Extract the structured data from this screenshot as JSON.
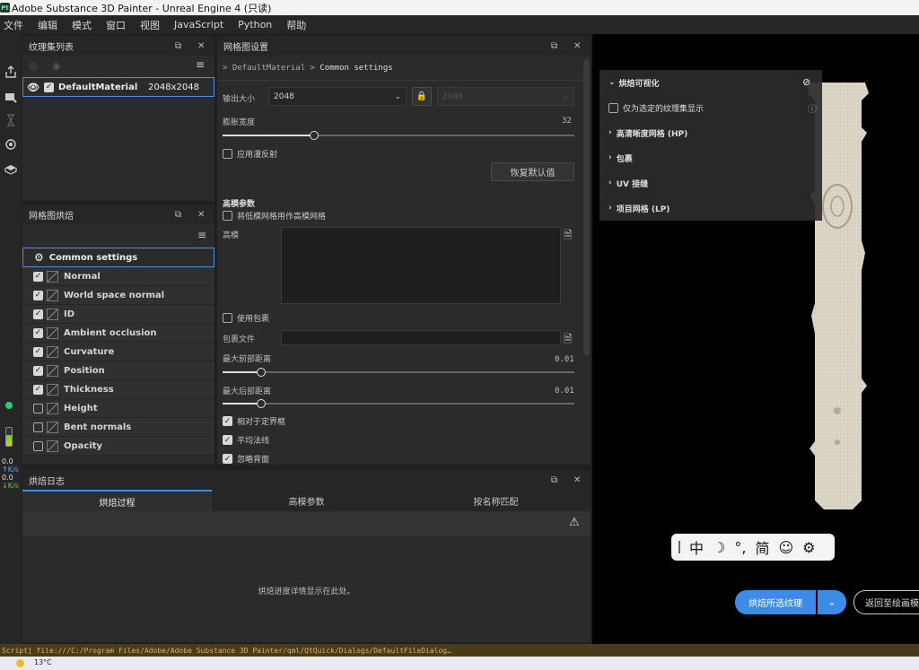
{
  "window": {
    "app_icon": "Pt",
    "title": "Adobe Substance 3D Painter - Unreal Engine 4 (只读)"
  },
  "menu": [
    "文件",
    "编辑",
    "模式",
    "窗口",
    "视图",
    "JavaScript",
    "Python",
    "帮助"
  ],
  "leftbar": {
    "rate1_value": "0.0",
    "rate1_unit": "K/s",
    "rate2_value": "0.0",
    "rate2_unit": "K/s"
  },
  "texture_sets": {
    "title": "纹理集列表",
    "material": {
      "name": "DefaultMaterial",
      "size": "2048x2048"
    }
  },
  "mesh_bake": {
    "title": "网格图烘焙",
    "common_settings": "Common settings",
    "maps": [
      {
        "name": "Normal",
        "checked": true
      },
      {
        "name": "World space normal",
        "checked": true
      },
      {
        "name": "ID",
        "checked": true
      },
      {
        "name": "Ambient occlusion",
        "checked": true
      },
      {
        "name": "Curvature",
        "checked": true
      },
      {
        "name": "Position",
        "checked": true
      },
      {
        "name": "Thickness",
        "checked": true
      },
      {
        "name": "Height",
        "checked": false
      },
      {
        "name": "Bent normals",
        "checked": false
      },
      {
        "name": "Opacity",
        "checked": false
      }
    ]
  },
  "settings": {
    "title": "网格图设置",
    "breadcrumb_root": "DefaultMaterial",
    "breadcrumb_leaf": "Common settings",
    "output_size_label": "输出大小",
    "output_size_value": "2048",
    "output_size_locked_value": "2048",
    "dilation_label": "膨胀宽度",
    "dilation_value": "32",
    "dilation_fraction": 0.26,
    "apply_diffusion_label": "应用漫反射",
    "reset_button": "恢复默认值",
    "highpoly_section": "高模参数",
    "use_lowpoly_label": "将低模网格用作高模网格",
    "highpoly_label": "高模",
    "use_cage_label": "使用包裹",
    "cage_file_label": "包裹文件",
    "max_front_label": "最大前部距离",
    "max_front_value": "0.01",
    "max_front_fraction": 0.11,
    "max_rear_label": "最大后部距离",
    "max_rear_value": "0.01",
    "max_rear_fraction": 0.11,
    "relative_bbox_label": "相对于定界框",
    "average_normals_label": "平均法线",
    "ignore_backface_label": "忽略背面"
  },
  "bake_log": {
    "title": "烘焙日志",
    "tabs": [
      "烘焙过程",
      "高模参数",
      "按名称匹配"
    ],
    "empty_message": "烘焙进度详情显示在此处。"
  },
  "viewport": {
    "bake_visibility_title": "烘焙可视化",
    "only_selected_label": "仅为选定的纹理集显示",
    "items": [
      "高清晰度网格 (HP)",
      "包裹",
      "UV 接缝",
      "项目网格 (LP)"
    ],
    "ime_items": [
      "中",
      "☽",
      "°,",
      "简",
      "☺",
      "⚙"
    ],
    "bake_button": "烘焙所选纹理",
    "return_button": "返回至绘画模"
  },
  "status": {
    "text": "Script] file:///C:/Program Files/Adobe/Adobe Substance 3D Painter/qml/QtQuick/Dialogs/DefaultFileDialog…"
  },
  "taskbar": {
    "temperature": "13°C"
  },
  "colors": {
    "accent": "#3c8ce7",
    "selection_border": "#4a90e2",
    "green_status": "#2ecc71"
  }
}
